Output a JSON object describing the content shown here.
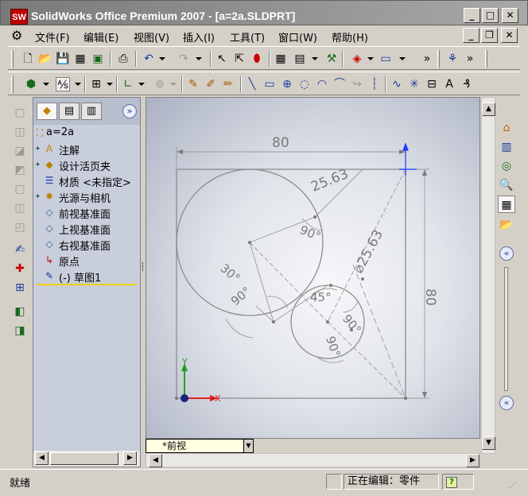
{
  "window": {
    "title": "SolidWorks Office Premium 2007 - [a=2a.SLDPRT]",
    "logo_text": "SW",
    "min_label": "_",
    "max_label": "□",
    "close_label": "✕",
    "doc_min_label": "_",
    "doc_restore_label": "❐",
    "doc_close_label": "✕"
  },
  "menu": [
    {
      "label": "文件(F)"
    },
    {
      "label": "编辑(E)"
    },
    {
      "label": "视图(V)"
    },
    {
      "label": "插入(I)"
    },
    {
      "label": "工具(T)"
    },
    {
      "label": "窗口(W)"
    },
    {
      "label": "帮助(H)"
    }
  ],
  "feature_tree": {
    "root": "a=2a",
    "items": [
      {
        "label": "注解",
        "icon": "annotation-icon",
        "glyph": "A",
        "expand": "+"
      },
      {
        "label": "设计活页夹",
        "icon": "design-binder-icon",
        "glyph": "◆",
        "expand": "+"
      },
      {
        "label": "材质 <未指定>",
        "icon": "material-icon",
        "glyph": "☰",
        "expand": ""
      },
      {
        "label": "光源与相机",
        "icon": "lights-camera-icon",
        "glyph": "✹",
        "expand": "+"
      },
      {
        "label": "前视基准面",
        "icon": "plane-icon",
        "glyph": "◇",
        "expand": ""
      },
      {
        "label": "上视基准面",
        "icon": "plane-icon",
        "glyph": "◇",
        "expand": ""
      },
      {
        "label": "右视基准面",
        "icon": "plane-icon",
        "glyph": "◇",
        "expand": ""
      },
      {
        "label": "原点",
        "icon": "origin-icon",
        "glyph": "↳",
        "expand": ""
      },
      {
        "label": "(-) 草图1",
        "icon": "sketch-icon",
        "glyph": "✎",
        "expand": ""
      }
    ]
  },
  "sketch": {
    "dims": {
      "width": "80",
      "height": "80",
      "radius_top": "25.63",
      "diameter_right": "⌀25.63",
      "angle_90_a": "90°",
      "angle_30": "30°",
      "angle_90_b": "90°",
      "angle_45": "45°",
      "angle_90_c": "90°",
      "angle_90_d": "90°"
    },
    "axis_x": "X",
    "axis_y": "Y"
  },
  "view_name": "*前视",
  "status": {
    "left": "就绪",
    "editing": "正在编辑：零件",
    "help": "?"
  },
  "colors": {
    "sketch_line": "#8c8c8c",
    "dimension": "#7a7a7a",
    "x_axis": "#e02020",
    "y_axis": "#20a020",
    "triad_origin": "#1a237e"
  }
}
